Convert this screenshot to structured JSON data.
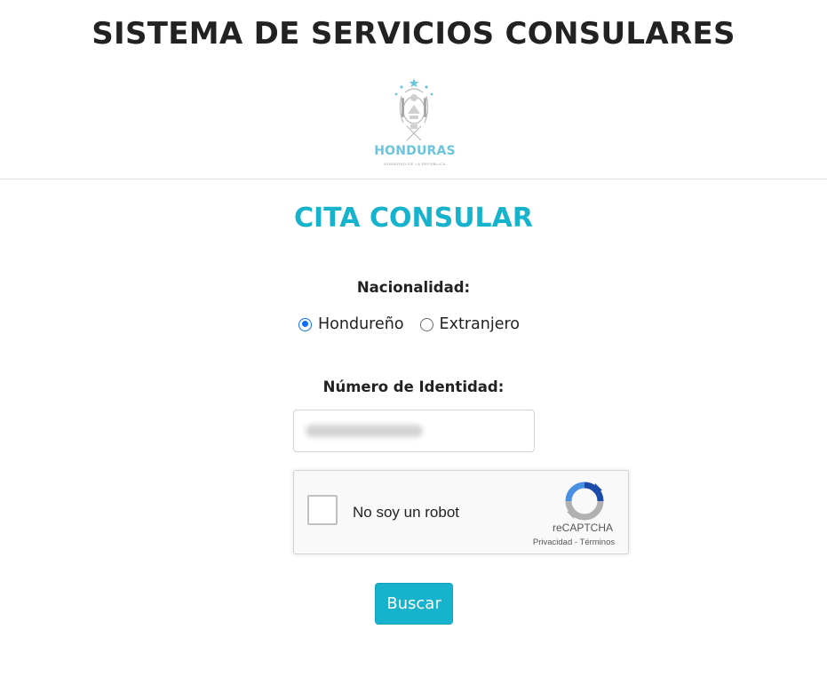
{
  "header": {
    "title": "SISTEMA DE SERVICIOS CONSULARES",
    "logo_text": "HONDURAS",
    "logo_subtext": "GOBIERNO DE LA REPÚBLICA"
  },
  "form": {
    "title": "CITA CONSULAR",
    "nationality_label": "Nacionalidad:",
    "nationality_options": [
      {
        "label": "Hondureño",
        "selected": true
      },
      {
        "label": "Extranjero",
        "selected": false
      }
    ],
    "id_label": "Número de Identidad:",
    "id_value": "",
    "submit_label": "Buscar"
  },
  "recaptcha": {
    "label": "No soy un robot",
    "brand": "reCAPTCHA",
    "privacy": "Privacidad",
    "separator": " - ",
    "terms": "Términos"
  },
  "colors": {
    "accent": "#17b3cc",
    "radio_checked": "#0d6efd",
    "logo": "#6cc5dd"
  }
}
